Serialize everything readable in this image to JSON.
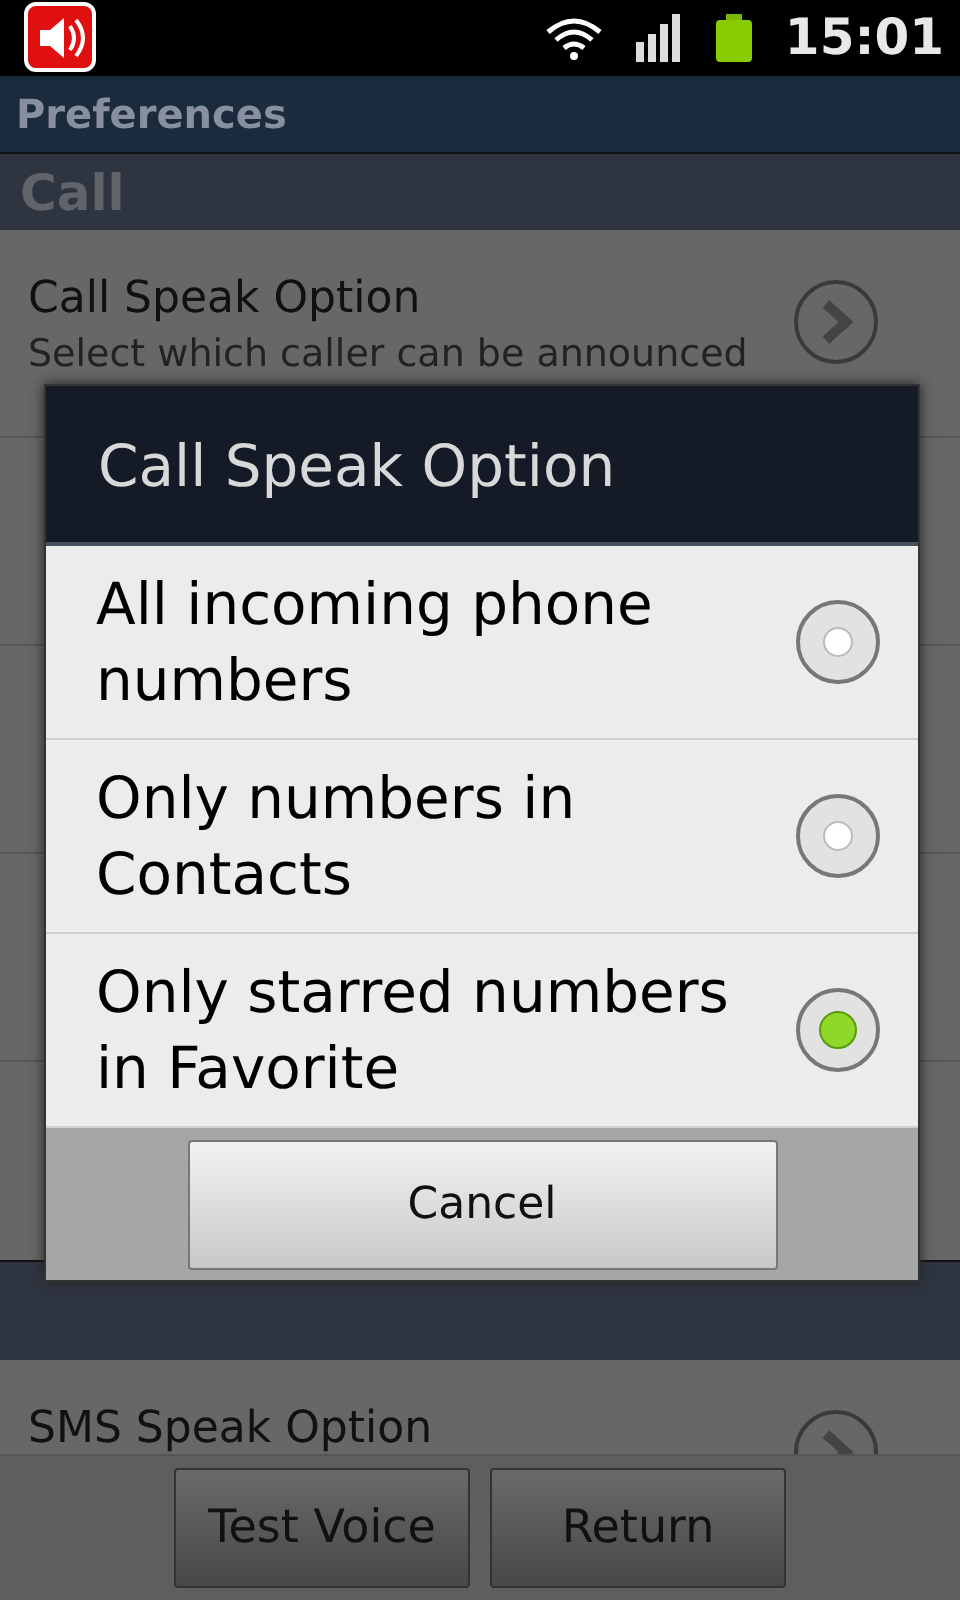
{
  "status_bar": {
    "time": "15:01"
  },
  "title": "Preferences",
  "call_section": {
    "header": "Call",
    "items": [
      {
        "title": "Call Speak Option",
        "summary": [
          "Select which caller can be announced"
        ],
        "arrow": true
      }
    ]
  },
  "sms_item": {
    "title": "SMS Speak Option",
    "arrow": true
  },
  "dialog": {
    "title": "Call Speak Option",
    "options": [
      {
        "label": "All incoming phone numbers",
        "selected": false
      },
      {
        "label": "Only numbers in Contacts",
        "selected": false
      },
      {
        "label": "Only starred numbers in Favorite",
        "selected": true
      }
    ],
    "cancel": "Cancel"
  },
  "buttons": [
    "Test Voice",
    "Return"
  ]
}
